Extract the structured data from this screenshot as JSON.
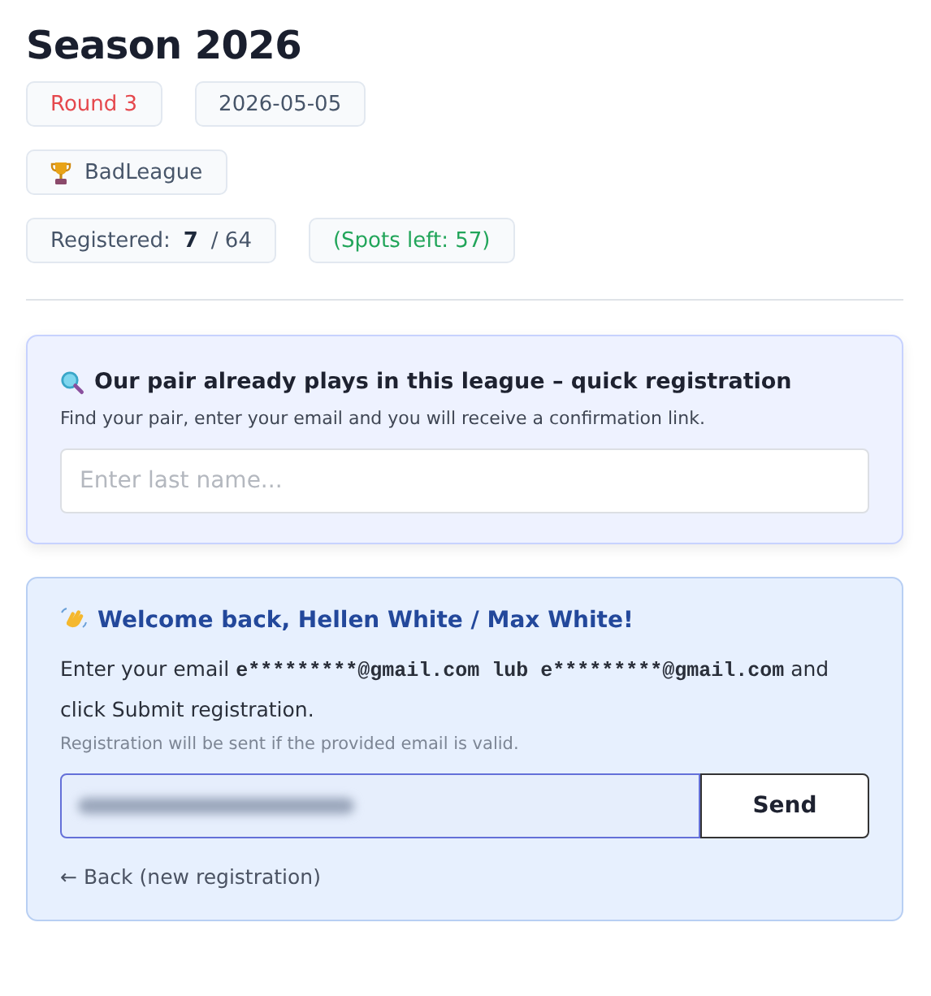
{
  "title": "Season 2026",
  "chips": [
    {
      "kind": "round",
      "text": "Round 3"
    },
    {
      "kind": "plain",
      "text": "2026-05-05"
    }
  ],
  "league": {
    "name": "BadLeague"
  },
  "stats": [
    {
      "kind": "plain",
      "text": "Registered: **7** / 64"
    },
    {
      "kind": "success",
      "text": "(Spots left: 57)"
    }
  ],
  "search_card": {
    "heading": "Our pair already plays in this league – quick registration",
    "hint": "Find your pair, enter your email and you will receive a confirmation link.",
    "field": {
      "placeholder": "Enter last name..."
    }
  },
  "welcome_card": {
    "heading": "Welcome back, Hellen White / Max White!",
    "instruction": [
      {
        "kind": "text",
        "text": "Enter your email "
      },
      {
        "kind": "code",
        "text": "e*********@gmail.com lub e*********@gmail.com"
      },
      {
        "kind": "text",
        "text": " and click Submit registration."
      }
    ],
    "note": "Registration will be sent if the provided email is valid.",
    "email_field": {
      "redacted": true,
      "focused": true
    },
    "button": "Send",
    "back_link": "← Back (new registration)"
  }
}
